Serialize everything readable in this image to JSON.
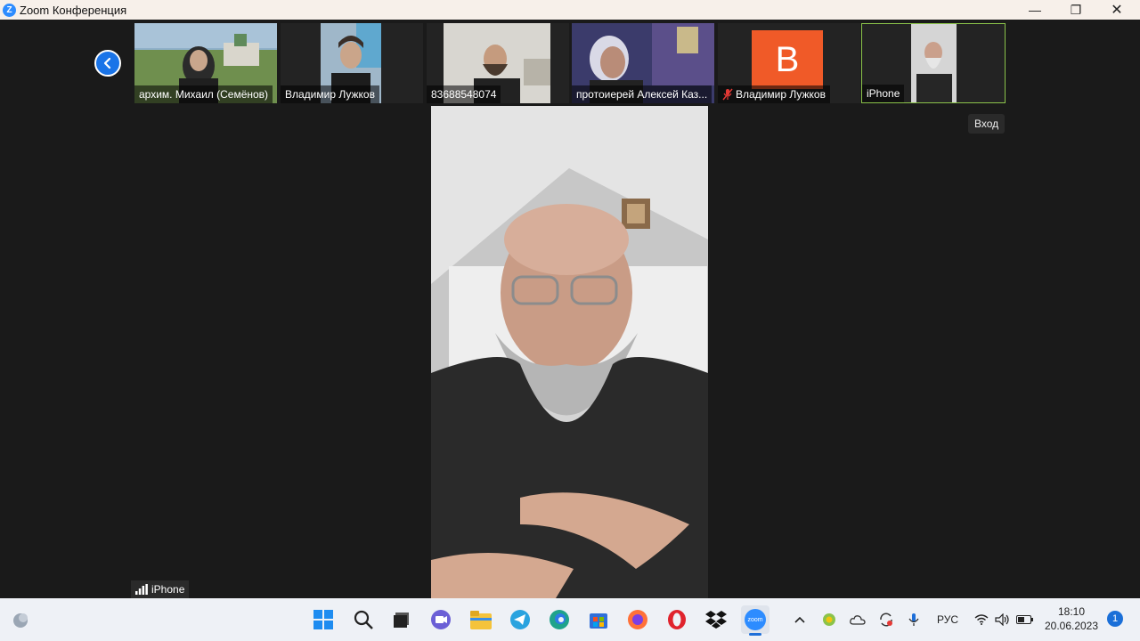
{
  "window": {
    "title": "Zoom Конференция",
    "logo_letter": "Z",
    "minimize": "—",
    "restore": "❐",
    "close": "✕"
  },
  "gallery": {
    "prev_icon": "chevron-left-icon",
    "tiles": [
      {
        "name": "архим. Михаил (Семёнов)",
        "muted": false
      },
      {
        "name": "Владимир Лужков",
        "muted": false
      },
      {
        "name": "83688548074",
        "muted": false
      },
      {
        "name": "протоиерей Алексей Каз...",
        "muted": false
      },
      {
        "name": "Владимир Лужков",
        "muted": true,
        "avatar_letter": "B",
        "avatar_color": "#f05a28"
      },
      {
        "name": "iPhone",
        "muted": false,
        "active": true
      }
    ]
  },
  "tooltip": {
    "text": "Вход"
  },
  "speaker": {
    "name": "iPhone"
  },
  "taskbar": {
    "language": "РУС",
    "time": "18:10",
    "date": "20.06.2023",
    "notifications": "1",
    "zoom_label": "zoom"
  },
  "colors": {
    "accent": "#2d8cff",
    "active_border": "#8bc34a",
    "muted_red": "#e53935"
  }
}
